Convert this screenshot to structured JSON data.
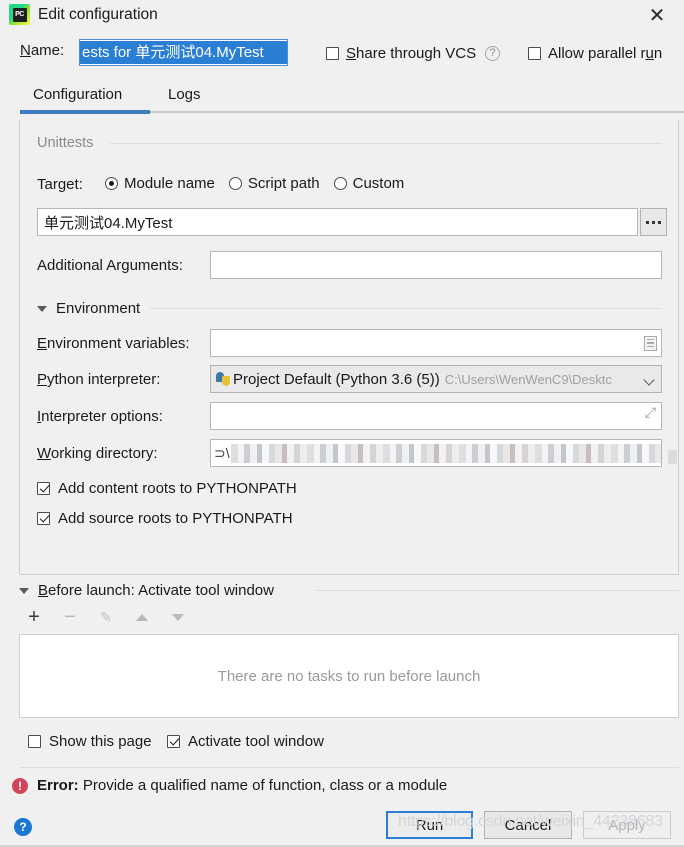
{
  "window": {
    "title": "Edit configuration",
    "app_icon": "pycharm-logo-icon",
    "logo_text": "PC",
    "close_icon": "✕"
  },
  "name_row": {
    "label": "Name:",
    "label_mnemonic": "N",
    "value": "ests for 单元测试04.MyTest",
    "share_vcs_label": "Share through VCS",
    "share_vcs_checked": false,
    "help_icon": "?",
    "allow_parallel_label": "Allow parallel run",
    "allow_parallel_checked": false
  },
  "tabs": {
    "items": [
      {
        "label": "Configuration",
        "active": true
      },
      {
        "label": "Logs",
        "active": false
      }
    ],
    "accent_color": "#3e7bc0"
  },
  "unittests": {
    "group_title": "Unittests",
    "target_label": "Target:",
    "target_options": [
      {
        "label": "Module name",
        "selected": true
      },
      {
        "label": "Script path",
        "selected": false
      },
      {
        "label": "Custom",
        "selected": false
      }
    ],
    "target_value": "单元测试04.MyTest",
    "browse_button": "...",
    "additional_arguments_label": "Additional Arguments:",
    "additional_arguments_value": ""
  },
  "environment": {
    "section_label": "Environment",
    "expanded": true,
    "env_vars_label": "Environment variables:",
    "env_vars_value": "",
    "interpreter_label": "Python interpreter:",
    "interpreter_value": "Project Default (Python 3.6 (5))",
    "interpreter_path": "C:\\Users\\WenWenC9\\Desktc",
    "interpreter_options_label": "Interpreter options:",
    "interpreter_options_value": "",
    "working_directory_label": "Working directory:",
    "working_directory_value": "⊃\\",
    "add_content_roots_label": "Add content roots to PYTHONPATH",
    "add_content_roots_checked": true,
    "add_source_roots_label": "Add source roots to PYTHONPATH",
    "add_source_roots_checked": true
  },
  "before_launch": {
    "header": "Before launch: Activate tool window",
    "header_mnemonic": "B",
    "expanded": true,
    "toolbar": {
      "add": "+",
      "remove": "−",
      "edit": "✎",
      "move_up": "▲",
      "move_down": "▼"
    },
    "empty_text": "There are no tasks to run before launch",
    "tasks": []
  },
  "bottom_options": {
    "show_page_label": "Show this page",
    "show_page_checked": false,
    "activate_tool_window_label": "Activate tool window",
    "activate_tool_window_checked": true
  },
  "error": {
    "icon": "error-icon",
    "prefix": "Error:",
    "message": "Provide a qualified name of function, class or a module",
    "color": "#d1455b"
  },
  "footer": {
    "help_label": "?",
    "run_label": "Run",
    "cancel_label": "Cancel",
    "apply_label": "Apply",
    "apply_enabled": false,
    "focus_color": "#2a7fd4"
  },
  "watermark": {
    "text": "https://blog.csdn.net/weixin_44238683"
  }
}
